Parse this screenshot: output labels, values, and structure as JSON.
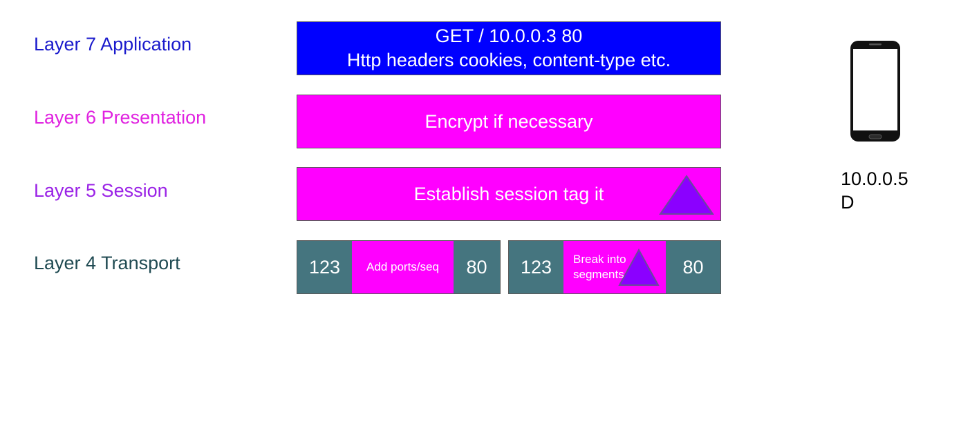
{
  "layers": [
    {
      "label": "Layer 7 Application",
      "color": "#1a1acc"
    },
    {
      "label": "Layer 6 Presentation",
      "color": "#e022e0"
    },
    {
      "label": "Layer 5 Session",
      "color": "#9a22e6"
    },
    {
      "label": "Layer 4 Transport",
      "color": "#1f4a52"
    }
  ],
  "application": {
    "line1": "GET / 10.0.0.3 80",
    "line2": "Http headers cookies, content-type etc.",
    "color": "#0000ff"
  },
  "presentation": {
    "text": "Encrypt if necessary",
    "color": "#ff00ff"
  },
  "session": {
    "text": "Establish session tag it",
    "color": "#ff00ff",
    "tag_color": "#8b00ff",
    "tag_icon": "triangle-tag-icon"
  },
  "transport": {
    "port_color": "#45757f",
    "payload_color": "#ff00ff",
    "segments": [
      {
        "src_port": "123",
        "payload": "Add ports/seq",
        "dst_port": "80"
      },
      {
        "src_port": "123",
        "payload_line1": "Break into",
        "payload_line2": "segments",
        "dst_port": "80"
      }
    ]
  },
  "device": {
    "icon": "smartphone-icon",
    "ip": "10.0.0.5",
    "name": "D"
  }
}
